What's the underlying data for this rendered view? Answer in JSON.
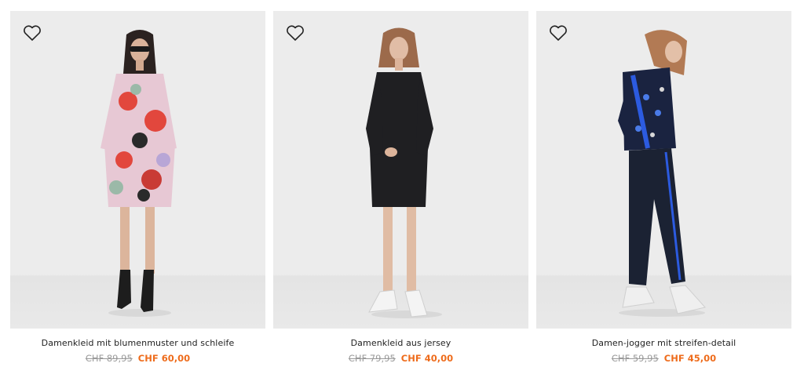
{
  "products": [
    {
      "title": "Damenkleid mit blumenmuster und schleife",
      "old_price": "CHF 89,95",
      "new_price": "CHF 60,00"
    },
    {
      "title": "Damenkleid aus jersey",
      "old_price": "CHF 79,95",
      "new_price": "CHF 40,00"
    },
    {
      "title": "Damen-jogger mit streifen-detail",
      "old_price": "CHF 59,95",
      "new_price": "CHF 45,00"
    }
  ],
  "icons": {
    "favorite": "heart-outline-icon"
  },
  "colors": {
    "sale_price": "#ee6c1c",
    "old_price": "#9a9a9a",
    "tile_background": "#ececec"
  }
}
